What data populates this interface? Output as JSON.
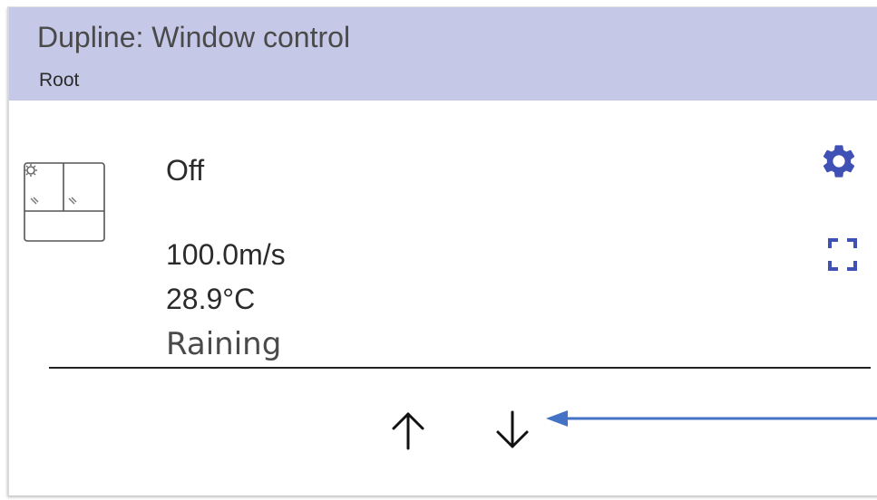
{
  "header": {
    "title": "Dupline: Window control",
    "subtitle": "Root"
  },
  "device": {
    "icon": "window-icon",
    "state": "Off",
    "wind_speed": "100.0m/s",
    "temperature": "28.9°C",
    "weather": "Raining"
  },
  "actions": {
    "settings_icon": "gear-icon",
    "fullscreen_icon": "fullscreen-icon",
    "up_icon": "arrow-up-icon",
    "down_icon": "arrow-down-icon"
  },
  "colors": {
    "header_bg": "#c5c8e7",
    "accent": "#3f51b5",
    "annotation_arrow": "#4472c4"
  }
}
